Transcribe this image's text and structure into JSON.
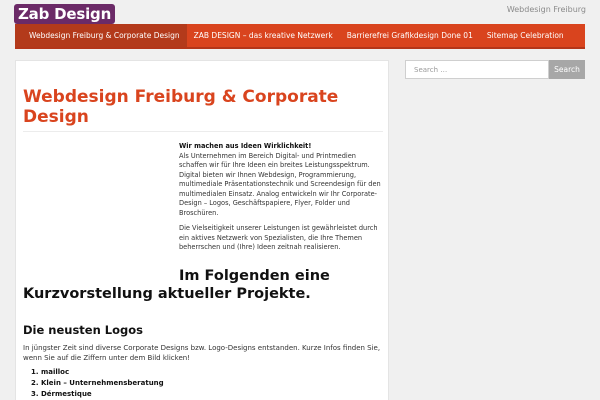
{
  "header": {
    "logo_text": "Zab Design",
    "tagline": "Webdesign Freiburg"
  },
  "nav": {
    "items": [
      {
        "label": "Webdesign Freiburg & Corporate Design",
        "active": true
      },
      {
        "label": "ZAB DESIGN – das kreative Netzwerk",
        "active": false
      },
      {
        "label": "Barrierefrei Grafikdesign Done 01",
        "active": false
      },
      {
        "label": "Sitemap Celebration",
        "active": false
      }
    ]
  },
  "main": {
    "title": "Webdesign Freiburg & Corporate Design",
    "intro_lead": "Wir machen aus Ideen Wirklichkeit!",
    "intro_text": "Als Unternehmen im Bereich Digital- und Printmedien schaffen wir für Ihre Ideen ein breites Leistungsspektrum. Digital bieten wir Ihnen Webdesign, Programmierung, multimediale Präsentationstechnik und Screendesign für den multimedialen Einsatz. Analog entwickeln wir Ihr Corporate-Design – Logos, Geschäftspapiere, Flyer, Folder und Broschüren.",
    "intro_text2": "Die Vielseitigkeit unserer Leistungen ist gewährleistet durch ein aktives Netzwerk von Spezialisten, die Ihre Themen beherrschen und (Ihre) Ideen zeitnah realisieren.",
    "projects_heading": "Im Folgenden eine Kurzvorstellung aktueller Projekte.",
    "logos_heading": "Die neusten Logos",
    "logos_desc": "In jüngster Zeit sind diverse Corporate Designs bzw. Logo-Designs entstanden. Kurze Infos finden Sie, wenn Sie auf die Ziffern unter dem Bild klicken!",
    "logos_list": [
      {
        "num": "1.",
        "label": "mailloc"
      },
      {
        "num": "2.",
        "label": "Klein – Unternehmensberatung"
      },
      {
        "num": "3.",
        "label": "Dérmestique"
      }
    ]
  },
  "sidebar": {
    "search_placeholder": "Search …",
    "search_button": "Search"
  },
  "colors": {
    "accent": "#d9441e",
    "logo_bg": "#6b2a67",
    "nav_active": "#b33a1b"
  }
}
